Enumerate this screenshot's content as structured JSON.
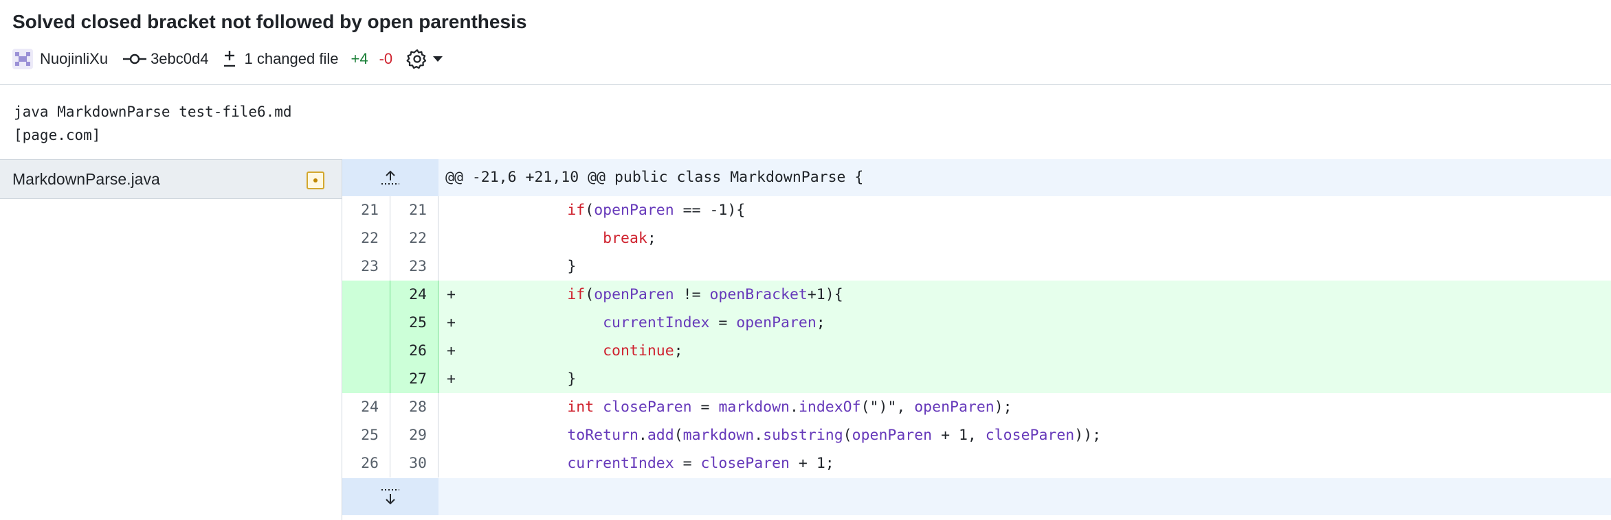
{
  "commit": {
    "title": "Solved closed bracket not followed by open parenthesis",
    "author": "NuojinliXu",
    "sha": "3ebc0d4",
    "changed_files": "1 changed file",
    "additions": "+4",
    "deletions": "-0",
    "message_lines": [
      "java MarkdownParse test-file6.md",
      "[page.com]"
    ]
  },
  "icons": {
    "avatar": "avatar-icon",
    "commit": "git-commit-icon",
    "diff": "file-diff-icon",
    "settings": "gear-icon",
    "caret": "caret-down-icon",
    "modified": "file-modified-icon",
    "expand_up": "expand-up-icon",
    "expand_down": "expand-down-icon"
  },
  "colors": {
    "added_bg": "#e6ffec",
    "added_gutter": "#ccffd8",
    "hunk_bg": "#eef5fd",
    "keyword": "#cf222e",
    "identifier": "#6639ba",
    "additions": "#1a7f37",
    "deletions": "#cf222e"
  },
  "file": {
    "name": "MarkdownParse.java"
  },
  "diff": {
    "hunk_header": "@@ -21,6 +21,10 @@ public class MarkdownParse {",
    "lines": [
      {
        "old": "21",
        "new": "21",
        "sign": "",
        "type": "context",
        "tokens": [
          [
            "",
            "            "
          ],
          [
            "kw",
            "if"
          ],
          [
            "",
            "("
          ],
          [
            "id",
            "openParen"
          ],
          [
            "",
            " == -1){"
          ]
        ]
      },
      {
        "old": "22",
        "new": "22",
        "sign": "",
        "type": "context",
        "tokens": [
          [
            "",
            "                "
          ],
          [
            "kw",
            "break"
          ],
          [
            "",
            ";"
          ]
        ]
      },
      {
        "old": "23",
        "new": "23",
        "sign": "",
        "type": "context",
        "tokens": [
          [
            "",
            "            }"
          ]
        ]
      },
      {
        "old": "",
        "new": "24",
        "sign": "+",
        "type": "added",
        "tokens": [
          [
            "",
            "            "
          ],
          [
            "kw",
            "if"
          ],
          [
            "",
            "("
          ],
          [
            "id",
            "openParen"
          ],
          [
            "",
            " != "
          ],
          [
            "id",
            "openBracket"
          ],
          [
            "",
            "+1){"
          ]
        ]
      },
      {
        "old": "",
        "new": "25",
        "sign": "+",
        "type": "added",
        "tokens": [
          [
            "",
            "                "
          ],
          [
            "id",
            "currentIndex"
          ],
          [
            "",
            " = "
          ],
          [
            "id",
            "openParen"
          ],
          [
            "",
            ";"
          ]
        ]
      },
      {
        "old": "",
        "new": "26",
        "sign": "+",
        "type": "added",
        "tokens": [
          [
            "",
            "                "
          ],
          [
            "kw",
            "continue"
          ],
          [
            "",
            ";"
          ]
        ]
      },
      {
        "old": "",
        "new": "27",
        "sign": "+",
        "type": "added",
        "tokens": [
          [
            "",
            "            }"
          ]
        ]
      },
      {
        "old": "24",
        "new": "28",
        "sign": "",
        "type": "context",
        "tokens": [
          [
            "",
            "            "
          ],
          [
            "kw",
            "int"
          ],
          [
            "",
            " "
          ],
          [
            "id",
            "closeParen"
          ],
          [
            "",
            " = "
          ],
          [
            "id",
            "markdown"
          ],
          [
            "",
            "."
          ],
          [
            "id",
            "indexOf"
          ],
          [
            "",
            "(\")\", "
          ],
          [
            "id",
            "openParen"
          ],
          [
            "",
            ");"
          ]
        ]
      },
      {
        "old": "25",
        "new": "29",
        "sign": "",
        "type": "context",
        "tokens": [
          [
            "",
            "            "
          ],
          [
            "id",
            "toReturn"
          ],
          [
            "",
            "."
          ],
          [
            "id",
            "add"
          ],
          [
            "",
            "("
          ],
          [
            "id",
            "markdown"
          ],
          [
            "",
            "."
          ],
          [
            "id",
            "substring"
          ],
          [
            "",
            "("
          ],
          [
            "id",
            "openParen"
          ],
          [
            "",
            " + 1, "
          ],
          [
            "id",
            "closeParen"
          ],
          [
            "",
            "));"
          ]
        ]
      },
      {
        "old": "26",
        "new": "30",
        "sign": "",
        "type": "context",
        "tokens": [
          [
            "",
            "            "
          ],
          [
            "id",
            "currentIndex"
          ],
          [
            "",
            " = "
          ],
          [
            "id",
            "closeParen"
          ],
          [
            "",
            " + 1;"
          ]
        ]
      }
    ]
  }
}
